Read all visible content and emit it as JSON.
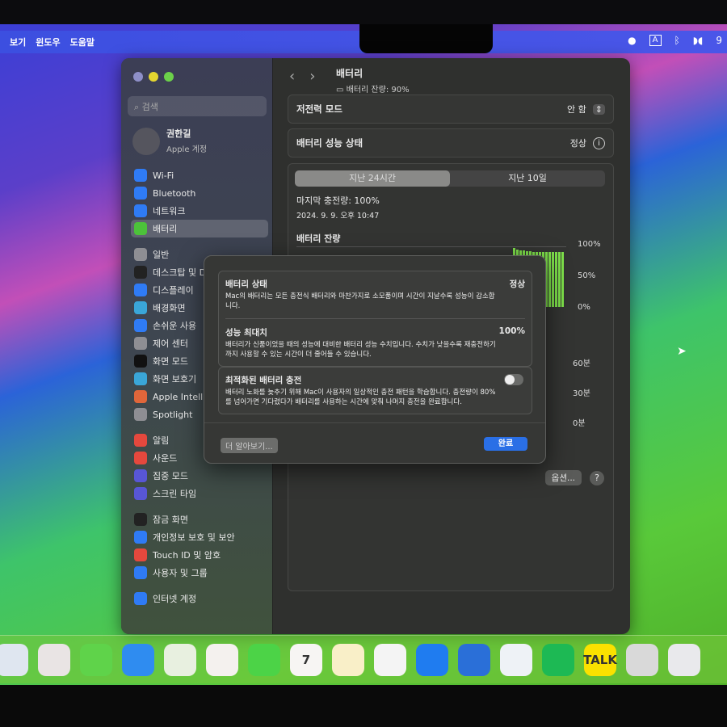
{
  "menubar": {
    "items": [
      "보기",
      "윈도우",
      "도움말"
    ],
    "tray": [
      "apple-icon",
      "input-A",
      "bluetooth-icon",
      "airpods-icon",
      "9"
    ]
  },
  "sidebar": {
    "search_placeholder": "검색",
    "account": {
      "name": "권한길",
      "subtitle": "Apple 계정"
    },
    "groups": [
      [
        {
          "label": "Wi-Fi",
          "icon": "wifi-icon",
          "color": "#2f7bf5"
        },
        {
          "label": "Bluetooth",
          "icon": "bluetooth-icon",
          "color": "#2f7bf5"
        },
        {
          "label": "네트워크",
          "icon": "globe-icon",
          "color": "#2f7bf5"
        },
        {
          "label": "배터리",
          "icon": "battery-icon",
          "color": "#4cc23a",
          "selected": true
        }
      ],
      [
        {
          "label": "일반",
          "icon": "gear-icon",
          "color": "#8e8e93"
        },
        {
          "label": "데스크탑 및 Dock",
          "icon": "dock-icon",
          "color": "#222"
        },
        {
          "label": "디스플레이",
          "icon": "sun-icon",
          "color": "#2f7bf5"
        },
        {
          "label": "배경화면",
          "icon": "wallpaper-icon",
          "color": "#3aa6d8"
        },
        {
          "label": "손쉬운 사용",
          "icon": "accessibility-icon",
          "color": "#2f7bf5"
        },
        {
          "label": "제어 센터",
          "icon": "control-center-icon",
          "color": "#8e8e93"
        },
        {
          "label": "화면 모드",
          "icon": "appearance-icon",
          "color": "#111"
        },
        {
          "label": "화면 보호기",
          "icon": "screensaver-icon",
          "color": "#3aa6d8"
        },
        {
          "label": "Apple Intelligence 및 Siri",
          "icon": "siri-icon",
          "color": "#e0663a"
        },
        {
          "label": "Spotlight",
          "icon": "spotlight-icon",
          "color": "#8e8e93"
        }
      ],
      [
        {
          "label": "알림",
          "icon": "bell-icon",
          "color": "#e5483d"
        },
        {
          "label": "사운드",
          "icon": "sound-icon",
          "color": "#e5483d"
        },
        {
          "label": "집중 모드",
          "icon": "moon-icon",
          "color": "#5856d6"
        },
        {
          "label": "스크린 타임",
          "icon": "hourglass-icon",
          "color": "#5856d6"
        }
      ],
      [
        {
          "label": "잠금 화면",
          "icon": "lock-icon",
          "color": "#222"
        },
        {
          "label": "개인정보 보호 및 보안",
          "icon": "hand-icon",
          "color": "#2f7bf5"
        },
        {
          "label": "Touch ID 및 암호",
          "icon": "fingerprint-icon",
          "color": "#e5483d"
        },
        {
          "label": "사용자 및 그룹",
          "icon": "users-icon",
          "color": "#2f7bf5"
        }
      ],
      [
        {
          "label": "인터넷 계정",
          "icon": "at-icon",
          "color": "#2f7bf5"
        }
      ]
    ]
  },
  "main": {
    "title": "배터리",
    "subtitle": "배터리 잔량: 90%",
    "low_power": {
      "label": "저전력 모드",
      "value": "안 함"
    },
    "health": {
      "label": "배터리 성능 상태",
      "value": "정상"
    },
    "tabs": [
      "지난 24시간",
      "지난 10일"
    ],
    "last_charge": "마지막 충전량: 100%",
    "last_charge_time": "2024. 9. 9. 오후 10:47",
    "level_label": "배터리 잔량",
    "level_ticks": [
      "100%",
      "50%",
      "0%"
    ],
    "level_values": [
      98,
      95,
      94,
      93,
      92,
      92,
      91,
      91,
      91,
      91,
      91,
      91,
      91,
      91,
      91,
      91
    ],
    "usage_ticks": [
      "60분",
      "30분",
      "0분"
    ],
    "options_button": "옵션...",
    "help_button": "?"
  },
  "dialog": {
    "status_title": "배터리 상태",
    "status_value": "정상",
    "status_desc": "Mac의 배터리는 모든 충전식 배터리와 마찬가지로 소모품이며 시간이 지날수록 성능이 감소합니다.",
    "max_title": "성능 최대치",
    "max_value": "100%",
    "max_desc": "배터리가 신품이었을 때의 성능에 대비한 배터리 성능 수치입니다. 수치가 낮을수록 재충전하기까지 사용할 수 있는 시간이 더 줄어들 수 있습니다.",
    "opt_title": "최적화된 배터리 충전",
    "opt_enabled": false,
    "opt_desc": "배터리 노화를 늦추기 위해 Mac이 사용자의 일상적인 충전 패턴을 학습합니다. 충전량이 80%를 넘어가면 기다렸다가 배터리를 사용하는 시간에 맞춰 나머지 충전을 완료합니다.",
    "learn_more": "더 알아보기...",
    "done": "완료"
  },
  "dock": [
    {
      "name": "finder",
      "color": "#dfe6f0"
    },
    {
      "name": "launchpad",
      "color": "#e9e4e4"
    },
    {
      "name": "messages",
      "color": "#5fd34a"
    },
    {
      "name": "mail",
      "color": "#2f8cf0"
    },
    {
      "name": "maps",
      "color": "#e8f0e0"
    },
    {
      "name": "photos",
      "color": "#f4f1ee"
    },
    {
      "name": "facetime",
      "color": "#4cd347"
    },
    {
      "name": "calendar",
      "color": "#f7f5f3",
      "text": "7"
    },
    {
      "name": "notes",
      "color": "#f9efc8"
    },
    {
      "name": "freeform",
      "color": "#f4f4f4"
    },
    {
      "name": "app-store",
      "color": "#1f7cf0"
    },
    {
      "name": "xcode",
      "color": "#2a6fd8"
    },
    {
      "name": "safari",
      "color": "#eef2f6"
    },
    {
      "name": "spotify",
      "color": "#1db954"
    },
    {
      "name": "kakaotalk",
      "color": "#fae100",
      "text": "TALK"
    },
    {
      "name": "system-settings",
      "color": "#d9d9d9"
    },
    {
      "name": "iphone-mirroring",
      "color": "#e9e9ec"
    }
  ]
}
